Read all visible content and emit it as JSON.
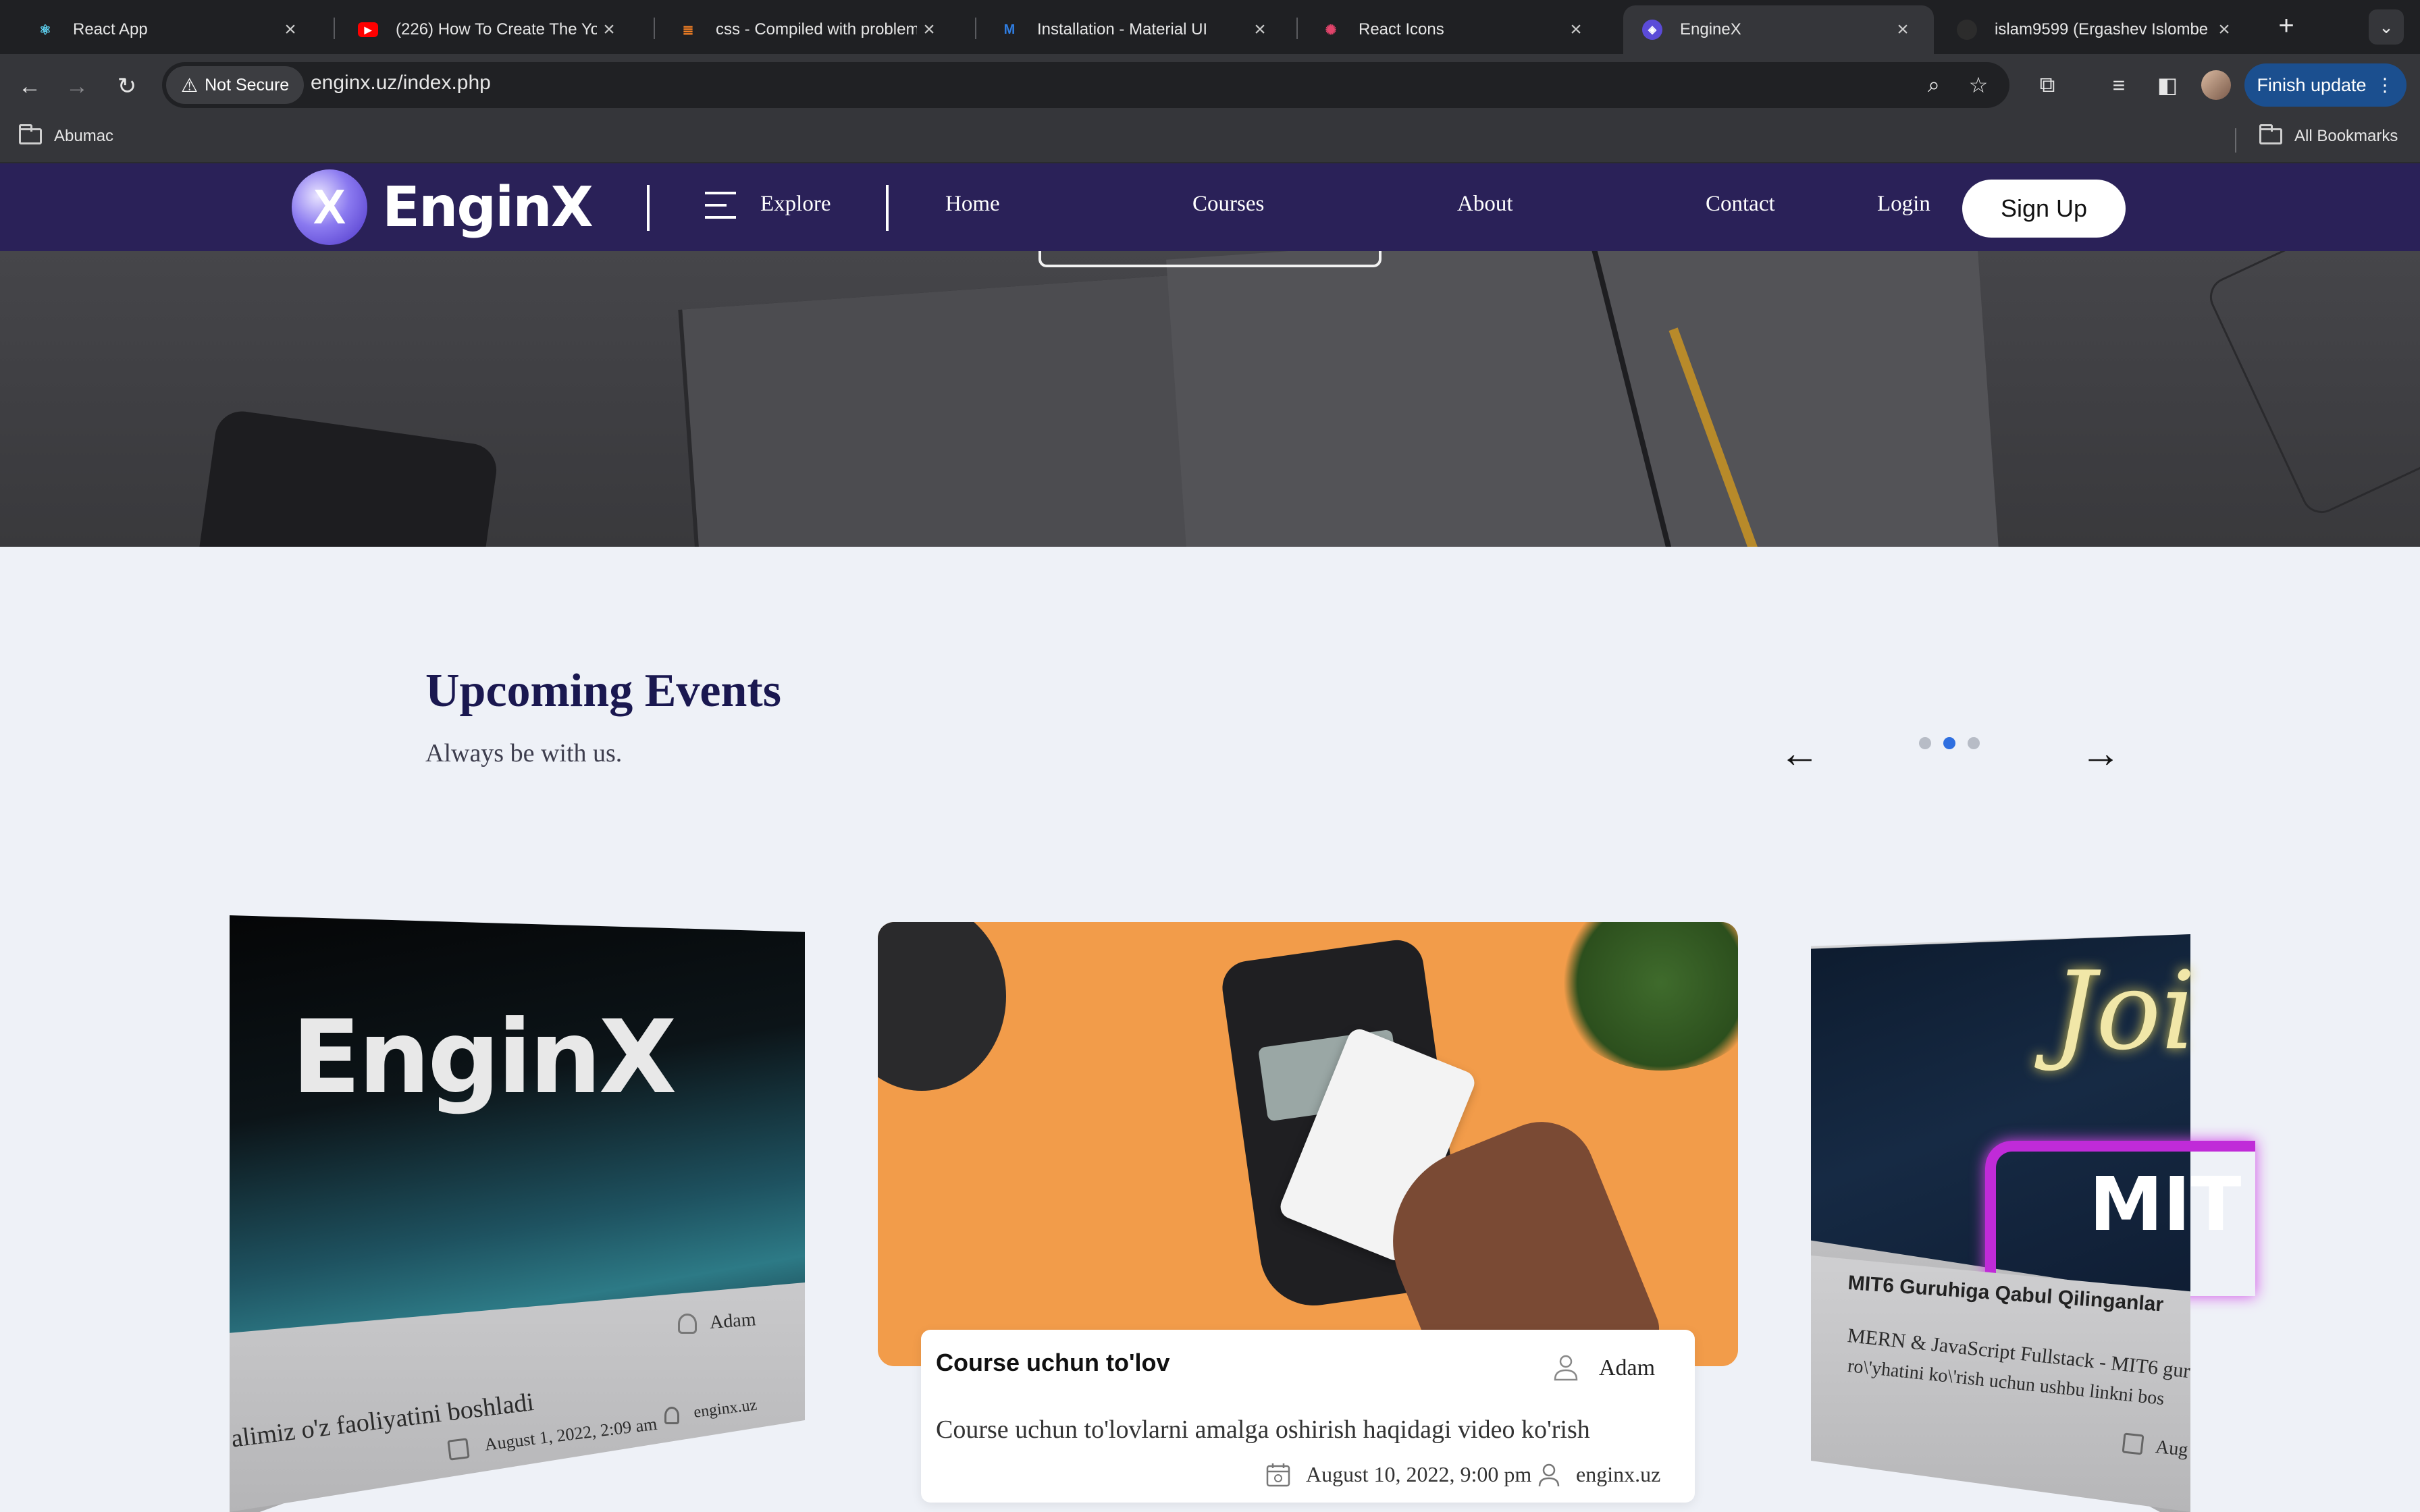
{
  "browser": {
    "tabs": [
      {
        "title": "React App",
        "icon": "react-icon",
        "active": false
      },
      {
        "title": "(226) How To Create The You",
        "icon": "youtube-icon",
        "active": false
      },
      {
        "title": "css - Compiled with problem",
        "icon": "stackoverflow-icon",
        "active": false
      },
      {
        "title": "Installation - Material UI",
        "icon": "mui-icon",
        "active": false
      },
      {
        "title": "React Icons",
        "icon": "react-icons-icon",
        "active": false
      },
      {
        "title": "EngineX",
        "icon": "enginex-icon",
        "active": true
      },
      {
        "title": "islam9599 (Ergashev Islombe",
        "icon": "github-icon",
        "active": false
      }
    ],
    "security_label": "Not Secure",
    "url": "enginx.uz/index.php",
    "finish_update": "Finish update",
    "bookmarks": [
      {
        "label": "Abumac"
      }
    ],
    "all_bookmarks": "All Bookmarks"
  },
  "site": {
    "logo_text": "EnginX",
    "explore": "Explore",
    "nav": [
      "Home",
      "Courses",
      "About",
      "Contact"
    ],
    "login": "Login",
    "signup": "Sign Up"
  },
  "events": {
    "title": "Upcoming Events",
    "subtitle": "Always be with us.",
    "prev_icon": "arrow-left-icon",
    "next_icon": "arrow-right-icon",
    "active_dot": 1,
    "cards": [
      {
        "image_text": "EnginX",
        "author": "Adam",
        "desc": "alimiz o'z faoliyatini boshladi",
        "date": "August 1, 2022, 2:09 am",
        "site": "enginx.uz"
      },
      {
        "title": "Course uchun to'lov",
        "author": "Adam",
        "desc": "Course uchun to'lovlarni amalga oshirish haqidagi video ko'rish",
        "date": "August 10, 2022, 9:00 pm",
        "site": "enginx.uz"
      },
      {
        "image_text_1": "Joi",
        "image_text_2": "MIT",
        "title": "MIT6 Guruhiga Qabul Qilinganlar",
        "desc_line1": "MERN & JavaScript Fullstack - MIT6 gur",
        "desc_line2": "ro\\'yhatini ko\\'rish uchun ushbu linkni bos",
        "date": "Aug"
      }
    ]
  },
  "colors": {
    "nav_bg": "#2a2158",
    "title": "#1a1850",
    "accent_dot": "#2f6fe0",
    "update_btn": "#1b4f8f"
  }
}
